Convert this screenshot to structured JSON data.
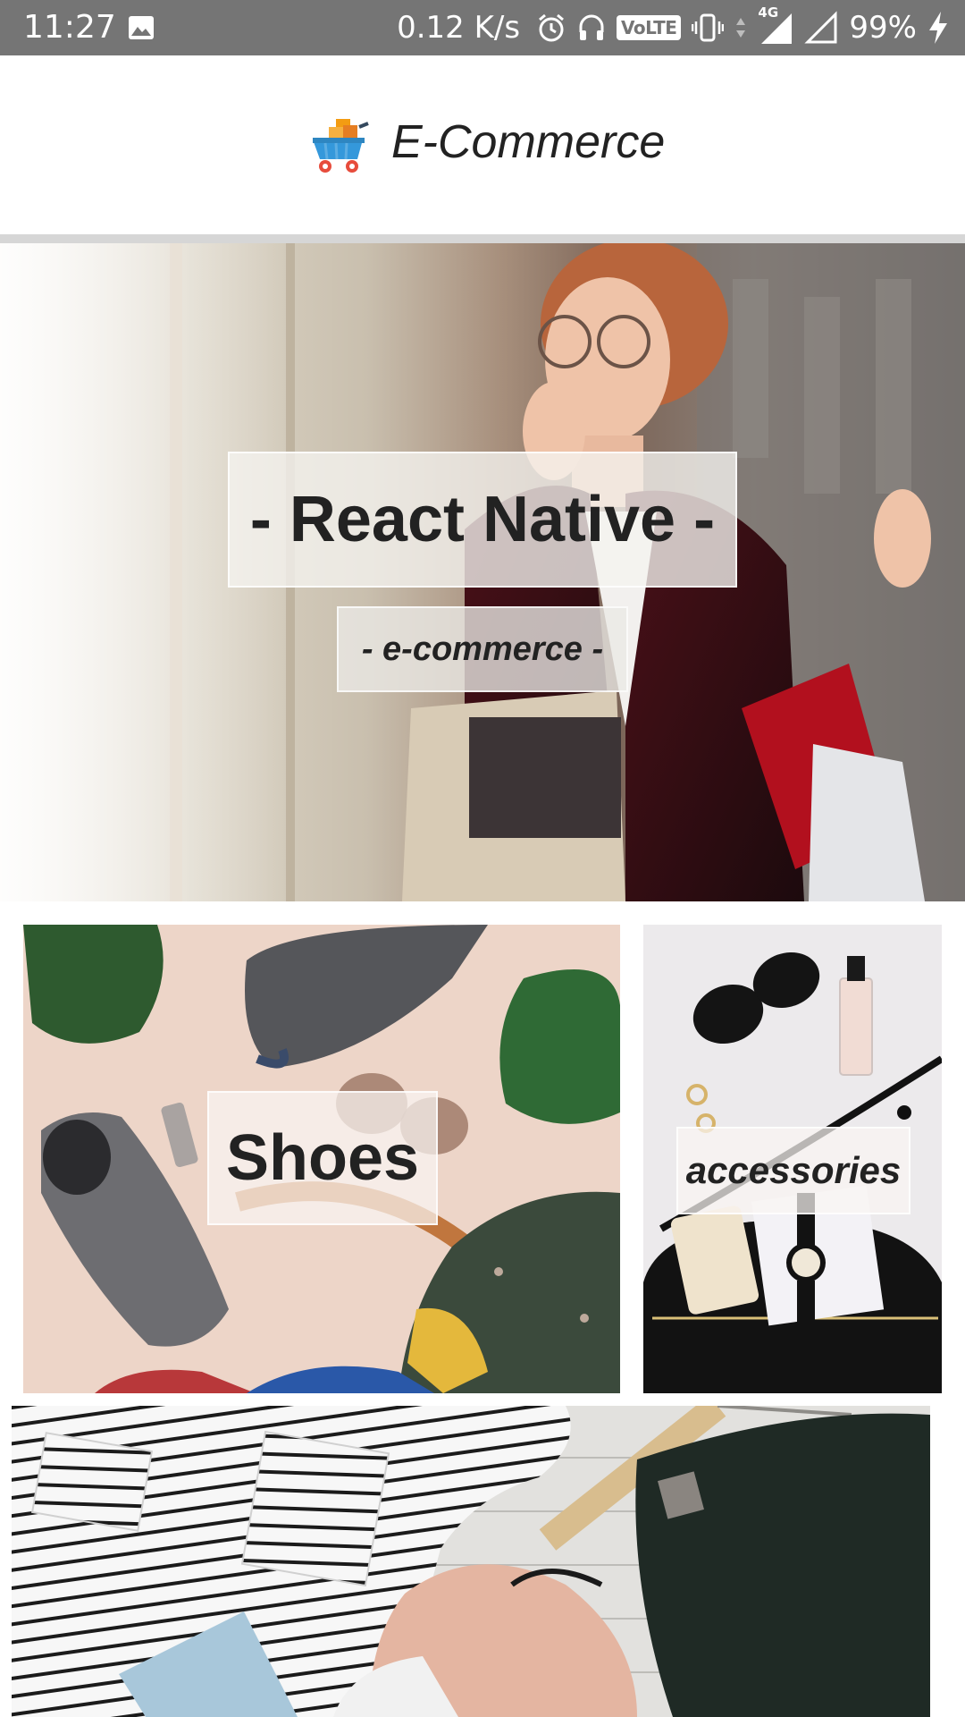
{
  "status_bar": {
    "time": "11:27",
    "net_speed": "0.12 K/s",
    "network_type": "4G",
    "volte": "VoLTE",
    "battery": "99%",
    "icons": [
      "gallery-icon",
      "alarm-icon",
      "headphones-icon",
      "volte-badge",
      "vibrate-icon",
      "data-arrows-icon",
      "signal-icon",
      "signal-empty-icon",
      "charging-icon"
    ]
  },
  "header": {
    "title": "E-Commerce",
    "logo_icon": "shopping-cart-icon"
  },
  "hero": {
    "title": "- React Native -",
    "subtitle": "- e-commerce -"
  },
  "categories": [
    {
      "label": "Shoes"
    },
    {
      "label": "accessories"
    },
    {
      "label": ""
    }
  ],
  "colors": {
    "status_bar_bg": "#757575",
    "divider": "#d6d6d6",
    "text_dark": "#222222",
    "background": "#ffffff"
  }
}
